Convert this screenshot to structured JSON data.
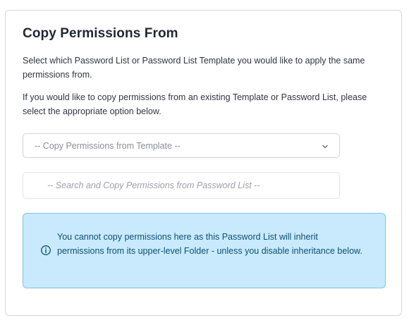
{
  "panel": {
    "title": "Copy Permissions From",
    "intro": "Select which Password List or Password List Template you would like to apply the same permissions from.",
    "instructions": "If you would like to copy permissions from an existing Template or Password List, please select the appropriate option below."
  },
  "template_select": {
    "selected": "-- Copy Permissions from Template --",
    "icon": "chevron-down-icon"
  },
  "list_search": {
    "value": "",
    "placeholder": "-- Search and Copy Permissions from Password List --"
  },
  "notice": {
    "icon": "info-icon",
    "text": "You cannot copy permissions here as this Password List will inherit permissions from its upper-level Folder - unless you disable inheritance below.",
    "colors": {
      "background": "#c8eafc",
      "border": "#7fc4ea",
      "text": "#0f4f73"
    }
  }
}
